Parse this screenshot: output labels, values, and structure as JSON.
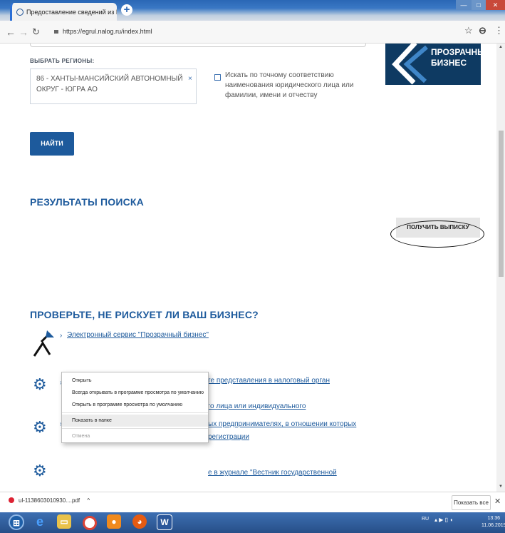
{
  "browser": {
    "tab_title": "Предоставление сведений из Е",
    "tab_close": "×",
    "new_tab": "+",
    "url": "https://egrul.nalog.ru/index.html",
    "win_min": "—",
    "win_max": "□",
    "win_close": "✕"
  },
  "form": {
    "regions_label": "ВЫБРАТЬ РЕГИОНЫ:",
    "region_value": "86 - ХАНТЫ-МАНСИЙСКИЙ АВТОНОМНЫЙ ОКРУГ - ЮГРА АО",
    "region_remove": "×",
    "exact_match_label": "Искать по точному соответствию наименования юридического лица или фамилии, имени и отчеству",
    "find_button": "НАЙТИ"
  },
  "banner": {
    "line1": "ПРОЗРАЧНЫЙ",
    "line2": "БИЗНЕС"
  },
  "results": {
    "heading": "РЕЗУЛЬТАТЫ ПОИСКА",
    "get_extract_button": "ПОЛУЧИТЬ ВЫПИСКУ"
  },
  "risk": {
    "heading": "ПРОВЕРЬТЕ, НЕ РИСКУЕТ ЛИ ВАШ БИЗНЕС?",
    "link1": "Электронный сервис \"Прозрачный бизнес\"",
    "link2_line1": "Запрос о направлении информации о факте представления в налоговый орган документов при",
    "link2_line2": "государственной регистрации юридического лица или индивидуального предпринимателя",
    "link3_line1": "ых предпринимателях, в отношении которых",
    "link3_line2": "регистрации",
    "link4": "е в журнале \"Вестник государственной"
  },
  "context_menu": {
    "items": [
      "Открыть",
      "Всегда открывать в программе просмотра по умолчанию",
      "Открыть в программе просмотра по умолчанию",
      "Показать в папке",
      "Отмена"
    ]
  },
  "download_bar": {
    "file_name": "ul-1138603010930....pdf",
    "caret": "^",
    "show_all": "Показать все",
    "close": "✕"
  },
  "taskbar": {
    "tray": "RU",
    "time": "13:36",
    "date": "11.06.2019"
  }
}
